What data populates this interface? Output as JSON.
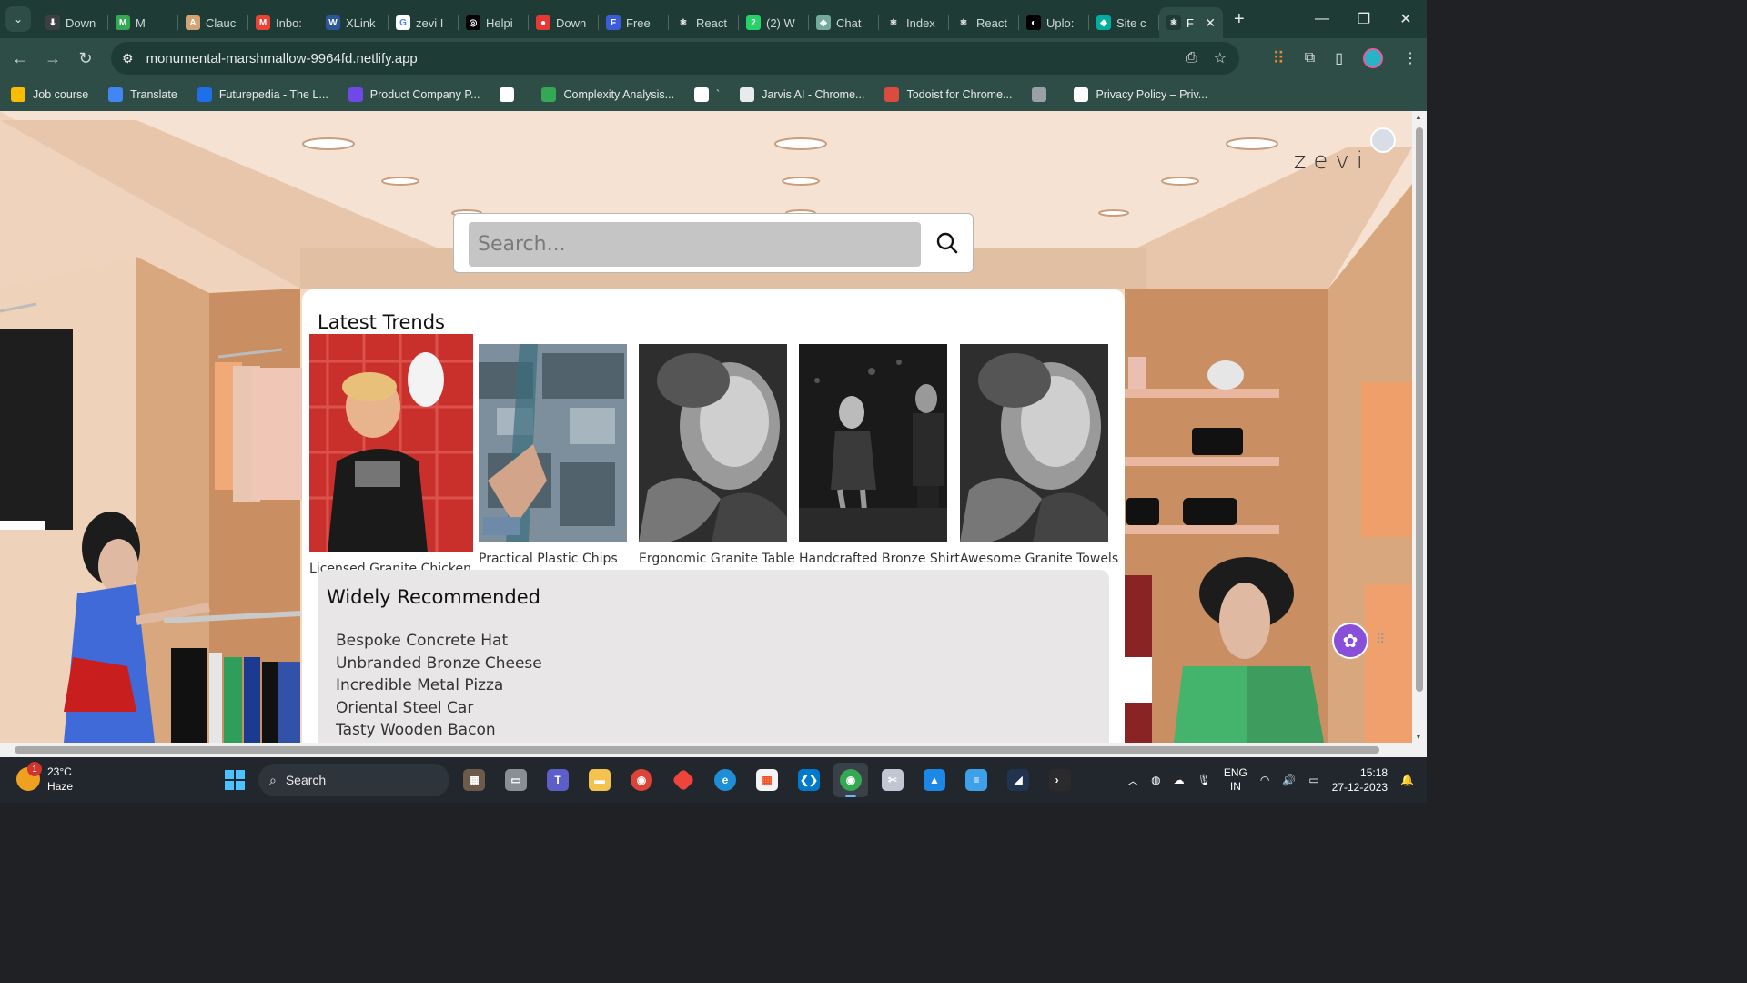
{
  "browser": {
    "tabs": [
      {
        "title": "Down",
        "color": "#3c4043",
        "glyph": "⬇"
      },
      {
        "title": "M",
        "color": "#34a853",
        "glyph": "M"
      },
      {
        "title": "Clauc",
        "color": "#d4a373",
        "glyph": "A"
      },
      {
        "title": "Inbo:",
        "color": "#ea4335",
        "glyph": "M"
      },
      {
        "title": "XLink",
        "color": "#2b579a",
        "glyph": "W"
      },
      {
        "title": "zevi I",
        "color": "#ffffff",
        "glyph": "G"
      },
      {
        "title": "Helpi",
        "color": "#000000",
        "glyph": "◎"
      },
      {
        "title": "Down",
        "color": "#e53935",
        "glyph": "●"
      },
      {
        "title": "Free",
        "color": "#3b5bdb",
        "glyph": "F"
      },
      {
        "title": "React",
        "color": "#1f3b36",
        "glyph": "⚛"
      },
      {
        "title": "(2) W",
        "color": "#25d366",
        "glyph": "2"
      },
      {
        "title": "Chat",
        "color": "#74aa9c",
        "glyph": "◈"
      },
      {
        "title": "Index",
        "color": "#1f3b36",
        "glyph": "⚛"
      },
      {
        "title": "React",
        "color": "#1f3b36",
        "glyph": "⚛"
      },
      {
        "title": "Uplo:",
        "color": "#000000",
        "glyph": "◐"
      },
      {
        "title": "Site c",
        "color": "#00ad9f",
        "glyph": "◆"
      },
      {
        "title": "F",
        "color": "#1f3b36",
        "glyph": "⚛",
        "active": true
      }
    ],
    "new_tab_label": "+",
    "address": "monumental-marshmallow-9964fd.netlify.app",
    "bookmarks": [
      {
        "label": "Job course",
        "color": "#fbbc04"
      },
      {
        "label": "Translate",
        "color": "#4285f4"
      },
      {
        "label": "Futurepedia - The L...",
        "color": "#1f6feb"
      },
      {
        "label": "Product Company P...",
        "color": "#7048e8"
      },
      {
        "label": "",
        "color": "#ffffff"
      },
      {
        "label": "Complexity Analysis...",
        "color": "#34a853"
      },
      {
        "label": "`",
        "color": "#ffffff"
      },
      {
        "label": "Jarvis AI - Chrome...",
        "color": "#e8eaed"
      },
      {
        "label": "Todoist for Chrome...",
        "color": "#db4c3f"
      },
      {
        "label": "",
        "color": "#9aa0a6"
      },
      {
        "label": "Privacy Policy – Priv...",
        "color": "#ffffff"
      }
    ]
  },
  "page": {
    "brand": "zevi",
    "search": {
      "placeholder": "Search..."
    },
    "latest_trends": {
      "title": "Latest Trends",
      "items": [
        {
          "name": "Licensed Granite Chicken",
          "tone": "color"
        },
        {
          "name": "Practical Plastic Chips",
          "tone": "color"
        },
        {
          "name": "Ergonomic Granite Table",
          "tone": "bw"
        },
        {
          "name": "Handcrafted Bronze Shirt",
          "tone": "bw"
        },
        {
          "name": "Awesome Granite Towels",
          "tone": "bw"
        }
      ]
    },
    "widely_recommended": {
      "title": "Widely Recommended",
      "items": [
        "Bespoke Concrete Hat",
        "Unbranded Bronze Cheese",
        "Incredible Metal Pizza",
        "Oriental Steel Car",
        "Tasty Wooden Bacon"
      ]
    }
  },
  "taskbar": {
    "weather": {
      "temp": "23°C",
      "condition": "Haze",
      "badge": "1"
    },
    "search_label": "Search",
    "apps": [
      "explorer-thumb",
      "file-manager",
      "teams",
      "folder",
      "chrome",
      "anydesk",
      "edge",
      "store",
      "vscode",
      "chrome-active",
      "snip",
      "photos",
      "notepad",
      "vpn",
      "terminal"
    ],
    "lang": {
      "line1": "ENG",
      "line2": "IN"
    },
    "clock": {
      "time": "15:18",
      "date": "27-12-2023"
    }
  },
  "colors": {
    "tabstrip": "#1f3b36",
    "toolbar": "#2f4d47",
    "wall": "#f3d9c4",
    "assistant": "#8a4fd8"
  }
}
